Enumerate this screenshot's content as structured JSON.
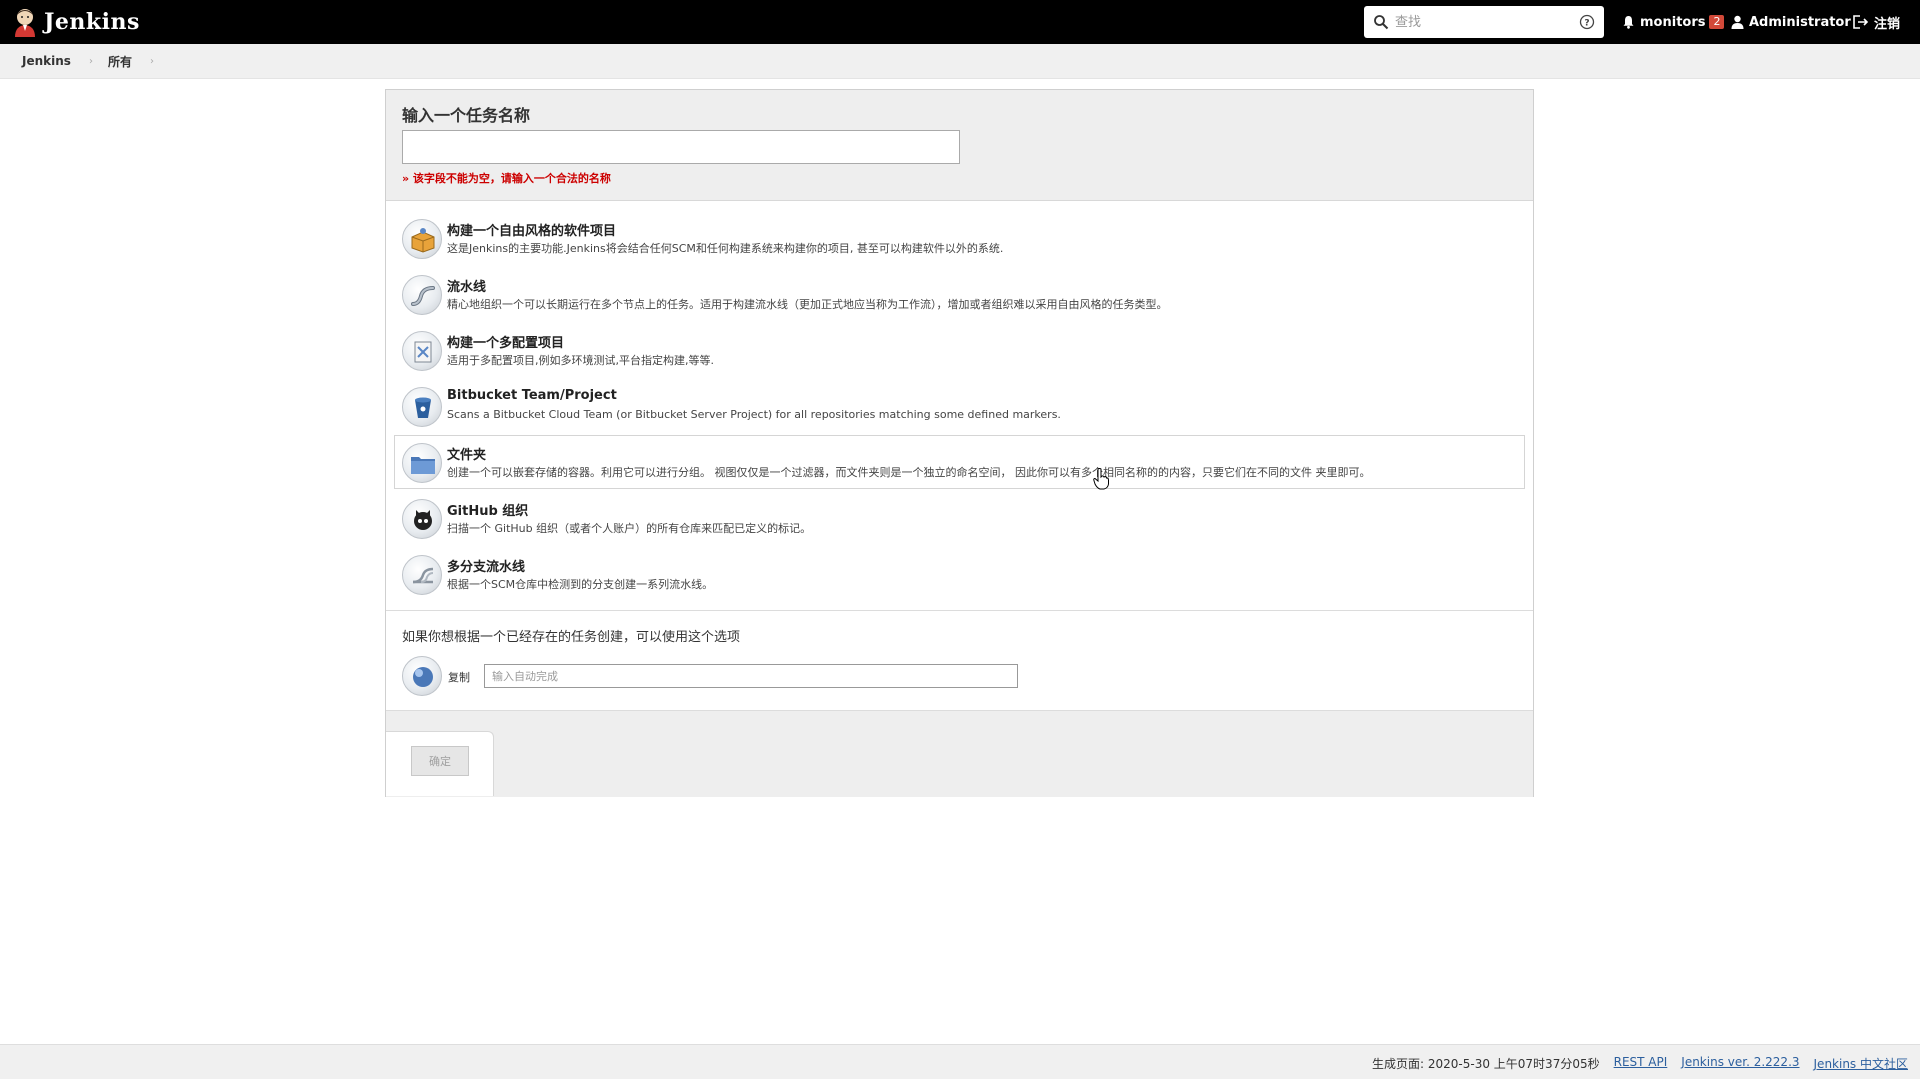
{
  "header": {
    "app_name": "Jenkins",
    "search_placeholder": "查找",
    "monitors_label": "monitors",
    "monitors_count": "2",
    "user_name": "Administrator",
    "logout_label": "注销"
  },
  "breadcrumb": {
    "items": [
      "Jenkins",
      "所有"
    ]
  },
  "new_item": {
    "title": "输入一个任务名称",
    "name_value": "",
    "error_text": "» 该字段不能为空，请输入一个合法的名称"
  },
  "item_types": [
    {
      "label": "构建一个自由风格的软件项目",
      "icon": "freestyle-box-icon",
      "desc": "这是Jenkins的主要功能.Jenkins将会结合任何SCM和任何构建系统来构建你的项目, 甚至可以构建软件以外的系统."
    },
    {
      "label": "流水线",
      "icon": "pipeline-icon",
      "desc": "精心地组织一个可以长期运行在多个节点上的任务。适用于构建流水线（更加正式地应当称为工作流），增加或者组织难以采用自由风格的任务类型。"
    },
    {
      "label": "构建一个多配置项目",
      "icon": "multi-config-icon",
      "desc": "适用于多配置项目,例如多环境测试,平台指定构建,等等."
    },
    {
      "label": "Bitbucket Team/Project",
      "icon": "bitbucket-icon",
      "desc": "Scans a Bitbucket Cloud Team (or Bitbucket Server Project) for all repositories matching some defined markers."
    },
    {
      "label": "文件夹",
      "icon": "folder-icon",
      "desc": "创建一个可以嵌套存储的容器。利用它可以进行分组。 视图仅仅是一个过滤器，而文件夹则是一个独立的命名空间， 因此你可以有多个相同名称的的内容，只要它们在不同的文件 夹里即可。"
    },
    {
      "label": "GitHub 组织",
      "icon": "github-icon",
      "desc": "扫描一个 GitHub 组织（或者个人账户）的所有仓库来匹配已定义的标记。"
    },
    {
      "label": "多分支流水线",
      "icon": "multibranch-icon",
      "desc": "根据一个SCM仓库中检测到的分支创建一系列流水线。"
    }
  ],
  "copy": {
    "hint": "如果你想根据一个已经存在的任务创建，可以使用这个选项",
    "label": "复制",
    "placeholder": "输入自动完成"
  },
  "ok_button": "确定",
  "footer": {
    "generated": "生成页面: 2020-5-30 上午07时37分05秒",
    "rest_api": "REST API",
    "version": "Jenkins ver. 2.222.3",
    "community": "Jenkins 中文社区"
  }
}
